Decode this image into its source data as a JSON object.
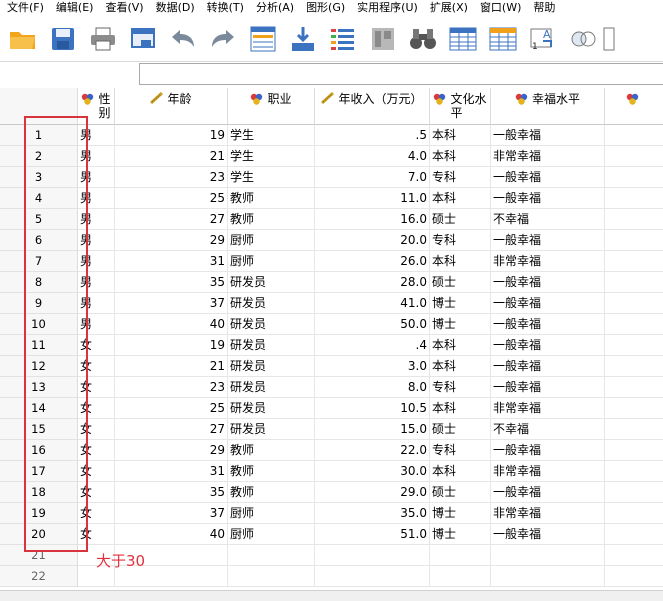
{
  "menu": [
    "文件(F)",
    "编辑(E)",
    "查看(V)",
    "数据(D)",
    "转换(T)",
    "分析(A)",
    "图形(G)",
    "实用程序(U)",
    "扩展(X)",
    "窗口(W)",
    "帮助"
  ],
  "toolbar_icons": [
    "open-folder-icon",
    "save-icon",
    "print-icon",
    "recall-dialog-icon",
    "undo-icon",
    "redo-icon",
    "goto-case-icon",
    "goto-variable-icon",
    "variables-icon",
    "run-descriptives-icon",
    "find-icon",
    "insert-cases-icon",
    "insert-variable-icon",
    "split-file-icon",
    "weight-cases-icon",
    "value-labels-icon"
  ],
  "columns": [
    {
      "label": "性\n别",
      "type": "nominal"
    },
    {
      "label": "年龄",
      "type": "scale"
    },
    {
      "label": "职业",
      "type": "nominal"
    },
    {
      "label": "年收入（万元）",
      "type": "scale"
    },
    {
      "label": "文化水\n平",
      "type": "nominal"
    },
    {
      "label": "幸福水平",
      "type": "nominal"
    },
    {
      "label": "",
      "type": "nominal"
    }
  ],
  "rows": [
    {
      "n": "1",
      "gender": "男",
      "age": "19",
      "job": "学生",
      "income": ".5",
      "edu": "本科",
      "happy": "一般幸福"
    },
    {
      "n": "2",
      "gender": "男",
      "age": "21",
      "job": "学生",
      "income": "4.0",
      "edu": "本科",
      "happy": "非常幸福"
    },
    {
      "n": "3",
      "gender": "男",
      "age": "23",
      "job": "学生",
      "income": "7.0",
      "edu": "专科",
      "happy": "一般幸福"
    },
    {
      "n": "4",
      "gender": "男",
      "age": "25",
      "job": "教师",
      "income": "11.0",
      "edu": "本科",
      "happy": "一般幸福"
    },
    {
      "n": "5",
      "gender": "男",
      "age": "27",
      "job": "教师",
      "income": "16.0",
      "edu": "硕士",
      "happy": "不幸福"
    },
    {
      "n": "6",
      "gender": "男",
      "age": "29",
      "job": "厨师",
      "income": "20.0",
      "edu": "专科",
      "happy": "一般幸福"
    },
    {
      "n": "7",
      "gender": "男",
      "age": "31",
      "job": "厨师",
      "income": "26.0",
      "edu": "本科",
      "happy": "非常幸福"
    },
    {
      "n": "8",
      "gender": "男",
      "age": "35",
      "job": "研发员",
      "income": "28.0",
      "edu": "硕士",
      "happy": "一般幸福"
    },
    {
      "n": "9",
      "gender": "男",
      "age": "37",
      "job": "研发员",
      "income": "41.0",
      "edu": "博士",
      "happy": "一般幸福"
    },
    {
      "n": "10",
      "gender": "男",
      "age": "40",
      "job": "研发员",
      "income": "50.0",
      "edu": "博士",
      "happy": "一般幸福"
    },
    {
      "n": "11",
      "gender": "女",
      "age": "19",
      "job": "研发员",
      "income": ".4",
      "edu": "本科",
      "happy": "一般幸福"
    },
    {
      "n": "12",
      "gender": "女",
      "age": "21",
      "job": "研发员",
      "income": "3.0",
      "edu": "本科",
      "happy": "一般幸福"
    },
    {
      "n": "13",
      "gender": "女",
      "age": "23",
      "job": "研发员",
      "income": "8.0",
      "edu": "专科",
      "happy": "一般幸福"
    },
    {
      "n": "14",
      "gender": "女",
      "age": "25",
      "job": "研发员",
      "income": "10.5",
      "edu": "本科",
      "happy": "非常幸福"
    },
    {
      "n": "15",
      "gender": "女",
      "age": "27",
      "job": "研发员",
      "income": "15.0",
      "edu": "硕士",
      "happy": "不幸福"
    },
    {
      "n": "16",
      "gender": "女",
      "age": "29",
      "job": "教师",
      "income": "22.0",
      "edu": "专科",
      "happy": "一般幸福"
    },
    {
      "n": "17",
      "gender": "女",
      "age": "31",
      "job": "教师",
      "income": "30.0",
      "edu": "本科",
      "happy": "非常幸福"
    },
    {
      "n": "18",
      "gender": "女",
      "age": "35",
      "job": "教师",
      "income": "29.0",
      "edu": "硕士",
      "happy": "一般幸福"
    },
    {
      "n": "19",
      "gender": "女",
      "age": "37",
      "job": "厨师",
      "income": "35.0",
      "edu": "博士",
      "happy": "非常幸福"
    },
    {
      "n": "20",
      "gender": "女",
      "age": "40",
      "job": "厨师",
      "income": "51.0",
      "edu": "博士",
      "happy": "一般幸福"
    },
    {
      "n": "21",
      "gender": "",
      "age": "",
      "job": "",
      "income": "",
      "edu": "",
      "happy": ""
    },
    {
      "n": "22",
      "gender": "",
      "age": "",
      "job": "",
      "income": "",
      "edu": "",
      "happy": ""
    }
  ],
  "annotation": "大于30",
  "colors": {
    "annotation": "#e0323e",
    "header_bg": "#ffffff",
    "rowheader_bg": "#f7f7f7"
  }
}
